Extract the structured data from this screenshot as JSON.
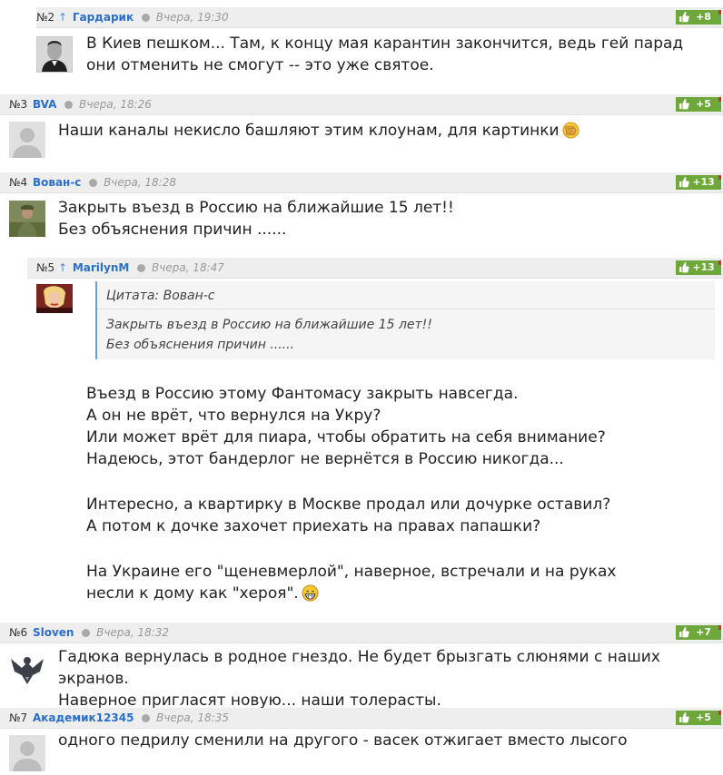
{
  "comments": [
    {
      "num": "№2",
      "reply_arrow": "↑",
      "author": "Гардарик",
      "time": "Вчера, 19:30",
      "rating": "+8",
      "text": "В Киев пешком... Там, к концу мая карантин закончится, ведь гей парад они отменить не смогут -- это уже святое.",
      "avatar": "portrait-avatar"
    },
    {
      "num": "№3",
      "author": "BVA",
      "time": "Вчера, 18:26",
      "rating": "+5",
      "text": "Наши каналы некисло башляют этим клоунам, для картинки",
      "avatar": "default-avatar"
    },
    {
      "num": "№4",
      "author": "Вован-с",
      "time": "Вчера, 18:28",
      "rating": "+13",
      "text": "Закрыть въезд в Россию на ближайшие 15 лет!!\nБез объяснения причин ......",
      "avatar": "soldier-avatar"
    },
    {
      "num": "№5",
      "reply_arrow": "↑",
      "author": "MarilynM",
      "time": "Вчера, 18:47",
      "rating": "+13",
      "quote_author": "Цитата: Вован-с",
      "quote_text": "Закрыть въезд в Россию на ближайшие 15 лет!!\nБез объяснения причин ......",
      "text_p1": "Въезд в Россию этому Фантомасу закрыть навсегда.\nА он не врёт, что вернулся на Укру?\nИли может врёт для пиара, чтобы обратить на себя внимание?\nНадеюсь, этот бандерлог не вернётся в Россию никогда...",
      "text_p2": "Интересно, а квартирку в Москве продал или дочурке оставил?\nА потом к дочке захочет приехать на правах папашки?",
      "text_p3": "На Украине его \"щеневмерлой\", наверное, встречали и на руках\nнесли к дому как \"хероя\".",
      "avatar": "marilyn-avatar"
    },
    {
      "num": "№6",
      "author": "Sloven",
      "time": "Вчера, 18:32",
      "rating": "+7",
      "text": "Гадюка вернулась в родное гнездо. Не будет брызгать слюнями с наших экранов.\nНаверное пригласят новую... наши толерасты.",
      "avatar": "eagle-avatar"
    },
    {
      "num": "№7",
      "author": "Академик12345",
      "time": "Вчера, 18:35",
      "rating": "+5",
      "text": "одного педрилу сменили на другого - васек отжигает вместо лысого",
      "avatar": "default-avatar"
    }
  ],
  "colors": {
    "rating_bg": "#6ea83b",
    "author": "#2a6fc9",
    "quote_border": "#6aa0d8",
    "header_bg": "#eeeeee"
  }
}
